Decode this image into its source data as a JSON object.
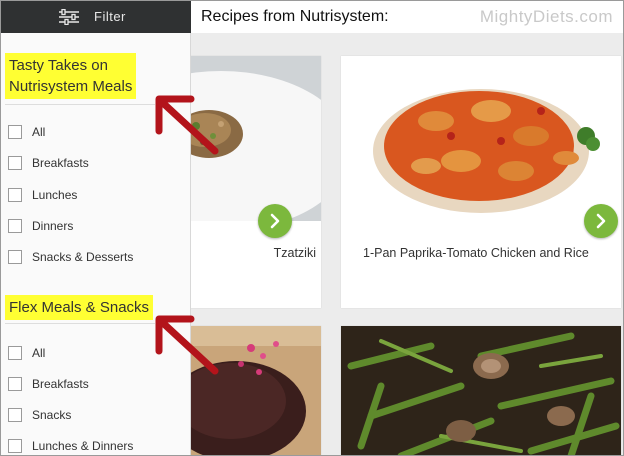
{
  "header": {
    "filter_label": "Filter",
    "page_title": "Recipes from Nutrisystem:",
    "watermark": "MightyDiets.com"
  },
  "sidebar": {
    "section1": {
      "title_line1": "Tasty Takes on",
      "title_line2": "Nutrisystem Meals",
      "options": [
        "All",
        "Breakfasts",
        "Lunches",
        "Dinners",
        "Snacks & Desserts"
      ]
    },
    "section2": {
      "title": "Flex Meals & Snacks",
      "options": [
        "All",
        "Breakfasts",
        "Snacks",
        "Lunches & Dinners"
      ]
    }
  },
  "cards": [
    {
      "caption": "Tzatziki"
    },
    {
      "caption": "1-Pan Paprika-Tomato Chicken and Rice"
    },
    {
      "caption": ""
    },
    {
      "caption": ""
    }
  ],
  "colors": {
    "highlight": "#ffff33",
    "arrow": "#b3141b",
    "go_button": "#7cb83d",
    "header_dark": "#2f3132"
  },
  "icons": {
    "filter": "sliders-icon",
    "card_go": "chevron-right-icon"
  }
}
